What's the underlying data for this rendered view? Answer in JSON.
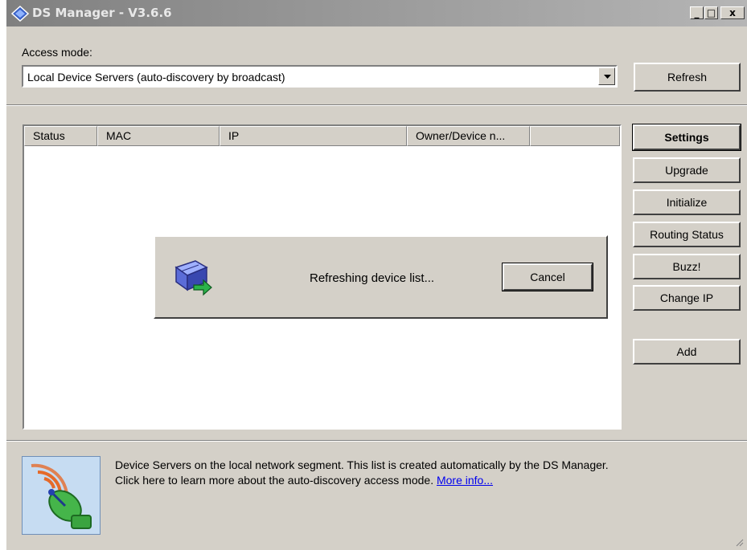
{
  "window": {
    "title": "DS Manager - V3.6.6",
    "controls": {
      "minimize": "_",
      "maximize": "□",
      "close": "x"
    }
  },
  "access": {
    "label": "Access mode:",
    "mode_value": "Local Device Servers (auto-discovery by broadcast)",
    "refresh_label": "Refresh"
  },
  "table": {
    "columns": [
      "Status",
      "MAC",
      "IP",
      "Owner/Device n..."
    ]
  },
  "side_buttons": {
    "settings": "Settings",
    "upgrade": "Upgrade",
    "initialize": "Initialize",
    "routing_status": "Routing Status",
    "buzz": "Buzz!",
    "change_ip": "Change IP",
    "add": "Add"
  },
  "dialog": {
    "message": "Refreshing device list...",
    "cancel_label": "Cancel"
  },
  "info": {
    "line1": "Device Servers on the local network segment. This list is created automatically by the DS Manager.",
    "line2": "Click here to learn more about the auto-discovery access mode.",
    "link": "More info..."
  }
}
